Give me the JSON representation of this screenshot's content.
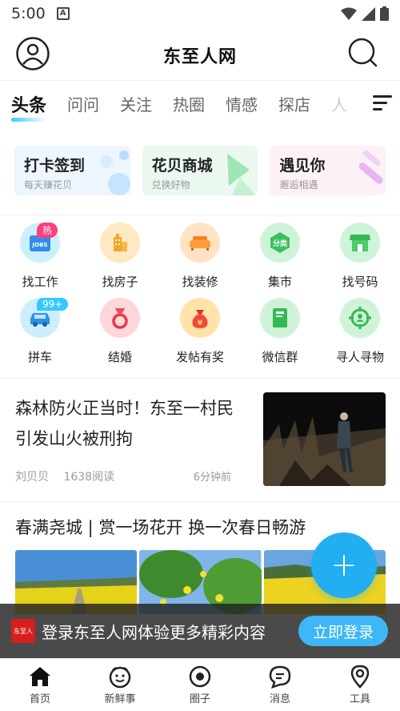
{
  "status_bar": {
    "time": "5:00",
    "notification_icon": "A"
  },
  "header": {
    "brand": "东至人网",
    "avatar_icon": "user-icon",
    "search_icon": "search-icon"
  },
  "tabs": {
    "items": [
      "头条",
      "问问",
      "关注",
      "热圈",
      "情感",
      "探店",
      "人"
    ],
    "active": 0,
    "menu_icon": "menu-icon"
  },
  "cards": [
    {
      "title": "打卡签到",
      "subtitle": "每天赚花贝"
    },
    {
      "title": "花贝商城",
      "subtitle": "兑换好物"
    },
    {
      "title": "遇见你",
      "subtitle": "邂逅相遇"
    }
  ],
  "grid": [
    {
      "label": "找工作",
      "icon": "jobs-icon",
      "badge": "热"
    },
    {
      "label": "找房子",
      "icon": "building-icon"
    },
    {
      "label": "找装修",
      "icon": "sofa-icon"
    },
    {
      "label": "集市",
      "icon": "category-icon",
      "icon_text": "分类"
    },
    {
      "label": "找号码",
      "icon": "shop-icon"
    },
    {
      "label": "拼车",
      "icon": "car-icon",
      "badge": "99+"
    },
    {
      "label": "结婚",
      "icon": "wedding-ring-icon"
    },
    {
      "label": "发帖有奖",
      "icon": "money-bag-icon"
    },
    {
      "label": "微信群",
      "icon": "book-icon"
    },
    {
      "label": "寻人寻物",
      "icon": "locate-person-icon"
    }
  ],
  "articles": [
    {
      "title": "森林防火正当时！东至一村民引发山火被刑拘",
      "author": "刘贝贝",
      "reads": "1638阅读",
      "time": "6分钟前"
    },
    {
      "title": "春满尧城 | 赏一场花开 换一次春日畅游"
    }
  ],
  "fab": {
    "label": "+"
  },
  "login_banner": {
    "logo_text": "东至人",
    "text": "登录东至人网体验更多精彩内容",
    "button": "立即登录"
  },
  "bottom_nav": [
    {
      "label": "首页",
      "icon": "home-icon"
    },
    {
      "label": "新鲜事",
      "icon": "smiley-icon"
    },
    {
      "label": "圈子",
      "icon": "circle-dot-icon"
    },
    {
      "label": "消息",
      "icon": "chat-icon"
    },
    {
      "label": "工具",
      "icon": "location-pin-icon"
    }
  ],
  "colors": {
    "accent": "#22aef0",
    "badge_hot": "#ff3d7f",
    "badge_count": "#35c8ff"
  }
}
